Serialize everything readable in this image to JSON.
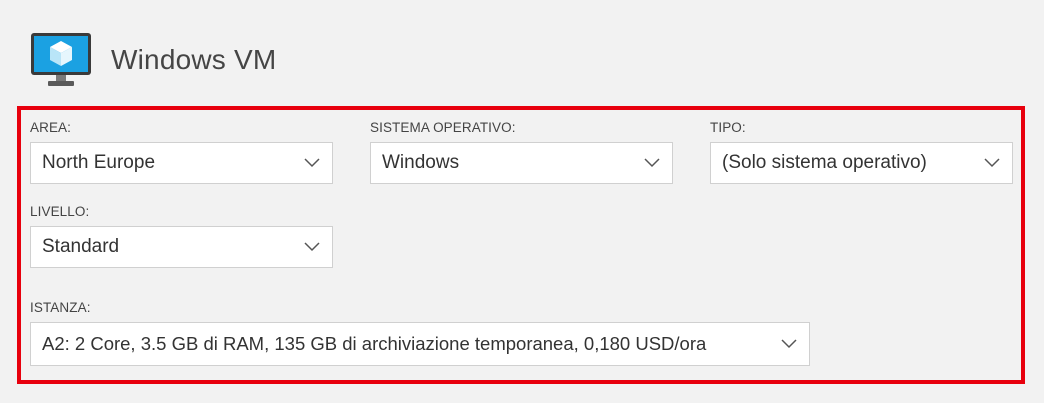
{
  "header": {
    "title": "Windows VM",
    "icon": "windows-vm-icon"
  },
  "form": {
    "area": {
      "label": "AREA:",
      "value": "North Europe"
    },
    "os": {
      "label": "SISTEMA OPERATIVO:",
      "value": "Windows"
    },
    "tipo": {
      "label": "TIPO:",
      "value": "(Solo sistema operativo)"
    },
    "livello": {
      "label": "LIVELLO:",
      "value": "Standard"
    },
    "istanza": {
      "label": "ISTANZA:",
      "value": "A2: 2 Core, 3.5 GB di RAM, 135 GB di archiviazione temporanea, 0,180 USD/ora"
    }
  },
  "colors": {
    "highlight": "#e8000d",
    "icon_screen": "#1ba1e2",
    "icon_frame": "#3a3a3a"
  }
}
